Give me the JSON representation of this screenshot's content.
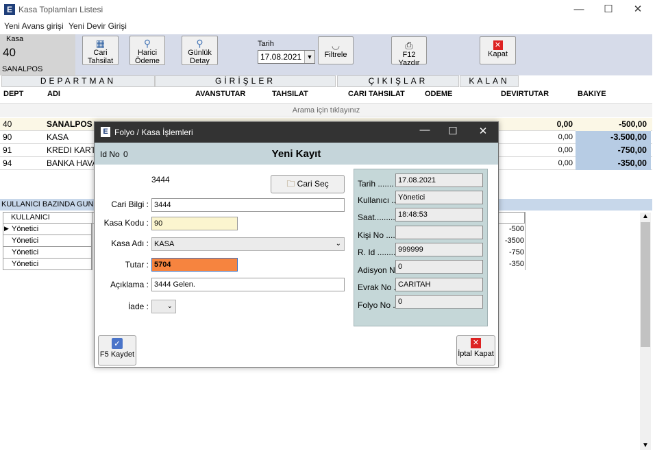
{
  "window": {
    "title": "Kasa Toplamları Listesi",
    "logo": "E"
  },
  "menu": [
    "Yeni Avans girişi",
    "Yeni Devir Girişi"
  ],
  "kasa": {
    "label": "Kasa",
    "code": "40",
    "name": "SANALPOS"
  },
  "toolbar": {
    "cari_tahsilat": [
      "Cari",
      "Tahsilat"
    ],
    "harici_odeme": [
      "Harici",
      "Ödeme"
    ],
    "gunluk_detay": [
      "Günlük",
      "Detay"
    ],
    "tarih_label": "Tarih",
    "tarih_value": "17.08.2021",
    "filtrele": "Filtrele",
    "yazdir": "F12 Yazdır",
    "kapat": "Kapat"
  },
  "groups": [
    "DEPARTMAN",
    "GİRİŞLER",
    "ÇIKIŞLAR",
    "KALAN"
  ],
  "columns": [
    "DEPT",
    "ADI",
    "AVANSTUTAR",
    "TAHSILAT",
    "CARI TAHSILAT",
    "ODEME",
    "DEVIRTUTAR",
    "BAKIYE"
  ],
  "search_hint": "Arama için tıklayınız",
  "rows": [
    {
      "dept": "40",
      "adi": "SANALPOS",
      "devir": "0,00",
      "bakiye": "-500,00"
    },
    {
      "dept": "90",
      "adi": "KASA",
      "devir": "0,00",
      "bakiye": "-3.500,00"
    },
    {
      "dept": "91",
      "adi": "KREDI KARTI",
      "devir": "0,00",
      "bakiye": "-750,00"
    },
    {
      "dept": "94",
      "adi": "BANKA HAVAL",
      "devir": "0,00",
      "bakiye": "-350,00"
    }
  ],
  "user_section": {
    "title": "KULLANICI BAZINDA GUNL",
    "header": "KULLANICI",
    "rows": [
      {
        "user": "Yönetici",
        "value": "-500"
      },
      {
        "user": "Yönetici",
        "value": "-3500"
      },
      {
        "user": "Yönetici",
        "value": "-750"
      },
      {
        "user": "Yönetici",
        "value": "-350"
      }
    ]
  },
  "dialog": {
    "title": "Folyo / Kasa İşlemleri",
    "id_label": "Id No",
    "id_value": "0",
    "heading": "Yeni Kayıt",
    "code_display": "3444",
    "cari_sec": "Cari Seç",
    "cari_bilgi_label": "Cari  Bilgi :",
    "cari_bilgi_value": "3444",
    "kasa_kodu_label": "Kasa Kodu :",
    "kasa_kodu_value": "90",
    "kasa_adi_label": "Kasa Adı :",
    "kasa_adi_value": "KASA",
    "tutar_label": "Tutar :",
    "tutar_value": "5704",
    "aciklama_label": "Açıklama :",
    "aciklama_value": "3444 Gelen.",
    "iade_label": "İade :",
    "right": {
      "tarih_label": "Tarih .......",
      "tarih": "17.08.2021",
      "kullanici_label": "Kullanıcı ...",
      "kullanici": "Yönetici",
      "saat_label": "Saat.........",
      "saat": "18:48:53",
      "kisi_label": "Kişi No .....",
      "kisi": "",
      "rid_label": "R. Id ........",
      "rid": "999999",
      "adisyon_label": "Adisyon N..",
      "adisyon": "0",
      "evrak_label": "Evrak No ..",
      "evrak": "CARITAH",
      "folyo_label": "Folyo No ..",
      "folyo": "0"
    },
    "kaydet": "F5 Kaydet",
    "iptal": "İptal Kapat"
  }
}
